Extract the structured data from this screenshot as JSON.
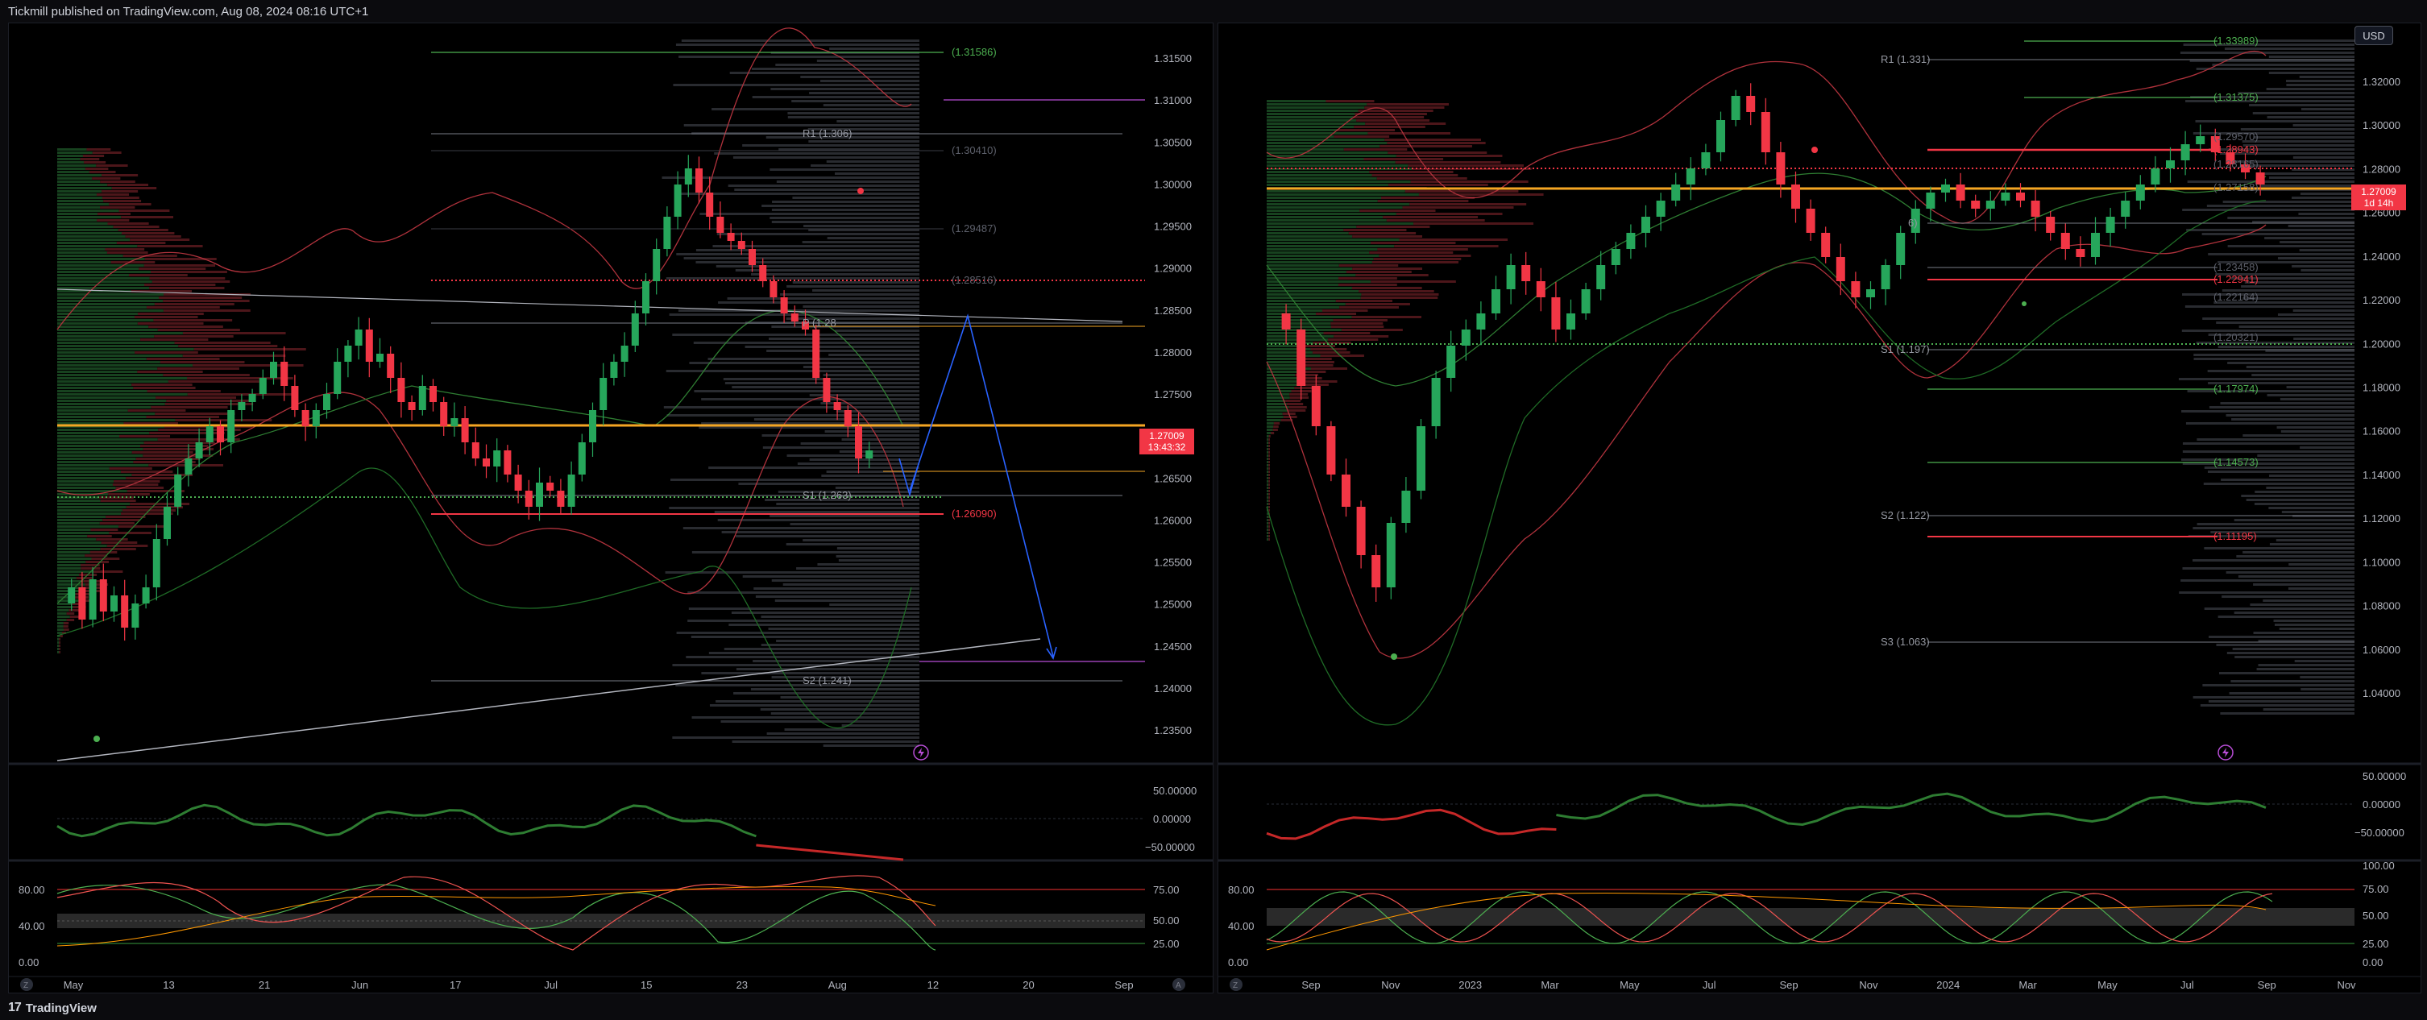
{
  "header": {
    "title": "Tickmill published on TradingView.com, Aug 08, 2024 08:16 UTC+1"
  },
  "footer": {
    "brand": "TradingView"
  },
  "left_chart": {
    "price_axis": [
      "1.31500",
      "1.31000",
      "1.30500",
      "1.30000",
      "1.29500",
      "1.29000",
      "1.28500",
      "1.28000",
      "1.27500",
      "1.27000",
      "1.26500",
      "1.26000",
      "1.25500",
      "1.25000",
      "1.24500",
      "1.24000",
      "1.23500"
    ],
    "time_axis": [
      "May",
      "13",
      "21",
      "Jun",
      "17",
      "Jul",
      "15",
      "23",
      "Aug",
      "12",
      "20",
      "Sep"
    ],
    "last_price": "1.27009",
    "countdown": "13:43:32",
    "level_labels": [
      {
        "text": "(1.31586)",
        "color": "#4caf50"
      },
      {
        "text": "R1 (1.306)",
        "color": "#9598a1"
      },
      {
        "text": "(1.30410)",
        "color": "#5d606b"
      },
      {
        "text": "(1.29487)",
        "color": "#5d606b"
      },
      {
        "text": "(1.28516)",
        "color": "#5d606b"
      },
      {
        "text": "P (1.28",
        "color": "#9598a1"
      },
      {
        "text": "S1 (1.263)",
        "color": "#9598a1"
      },
      {
        "text": "(1.26090)",
        "color": "#f23645"
      },
      {
        "text": "S2 (1.241)",
        "color": "#9598a1"
      }
    ],
    "osc1_axis": [
      "50.00000",
      "0.00000",
      "−50.00000"
    ],
    "osc2_left_axis": [
      "80.00",
      "40.00",
      "0.00"
    ],
    "osc2_right_axis": [
      "75.00",
      "50.00",
      "25.00"
    ],
    "time_axis_badges": [
      "Z",
      "A"
    ]
  },
  "right_chart": {
    "currency": "USD",
    "price_axis": [
      "1.32000",
      "1.30000",
      "1.28000",
      "1.26000",
      "1.24000",
      "1.22000",
      "1.20000",
      "1.18000",
      "1.16000",
      "1.14000",
      "1.12000",
      "1.10000",
      "1.08000",
      "1.06000",
      "1.04000"
    ],
    "time_axis": [
      "Sep",
      "Nov",
      "2023",
      "Mar",
      "May",
      "Jul",
      "Sep",
      "Nov",
      "2024",
      "Mar",
      "May",
      "Jul",
      "Sep",
      "Nov"
    ],
    "last_price": "1.27009",
    "countdown": "1d 14h",
    "level_labels": [
      {
        "text": "(1.33989)",
        "color": "#4caf50"
      },
      {
        "text": "R1 (1.331)",
        "color": "#9598a1"
      },
      {
        "text": "(1.31375)",
        "color": "#4caf50"
      },
      {
        "text": "(1.29570)",
        "color": "#5d606b"
      },
      {
        "text": "(1.28943)",
        "color": "#f23645"
      },
      {
        "text": "(1.28165)",
        "color": "#5d606b"
      },
      {
        "text": "(1.27158)",
        "color": "#5d606b"
      },
      {
        "text": "(1.23458)",
        "color": "#5d606b"
      },
      {
        "text": "(1.22941)",
        "color": "#f23645"
      },
      {
        "text": "(1.22164)",
        "color": "#5d606b"
      },
      {
        "text": "(1.20321)",
        "color": "#5d606b"
      },
      {
        "text": "S1 (1.197)",
        "color": "#9598a1"
      },
      {
        "text": "(1.17974)",
        "color": "#4caf50"
      },
      {
        "text": "(1.14573)",
        "color": "#4caf50"
      },
      {
        "text": "S2 (1.122)",
        "color": "#9598a1"
      },
      {
        "text": "(1.11195)",
        "color": "#f23645"
      },
      {
        "text": "S3 (1.063)",
        "color": "#9598a1"
      },
      {
        "text": "6)",
        "color": "#9598a1"
      }
    ],
    "osc1_axis": [
      "50.00000",
      "0.00000",
      "−50.00000"
    ],
    "osc2_left_axis": [
      "80.00",
      "40.00",
      "0.00"
    ],
    "osc2_right_axis": [
      "100.00",
      "75.00",
      "50.00",
      "25.00",
      "0.00"
    ],
    "time_axis_badges": [
      "Z"
    ]
  },
  "colors": {
    "up": "#26a65b",
    "down": "#f23645",
    "orange": "#f5a623",
    "purple": "#b84dd6",
    "blue": "#2962ff",
    "background": "#000000"
  }
}
